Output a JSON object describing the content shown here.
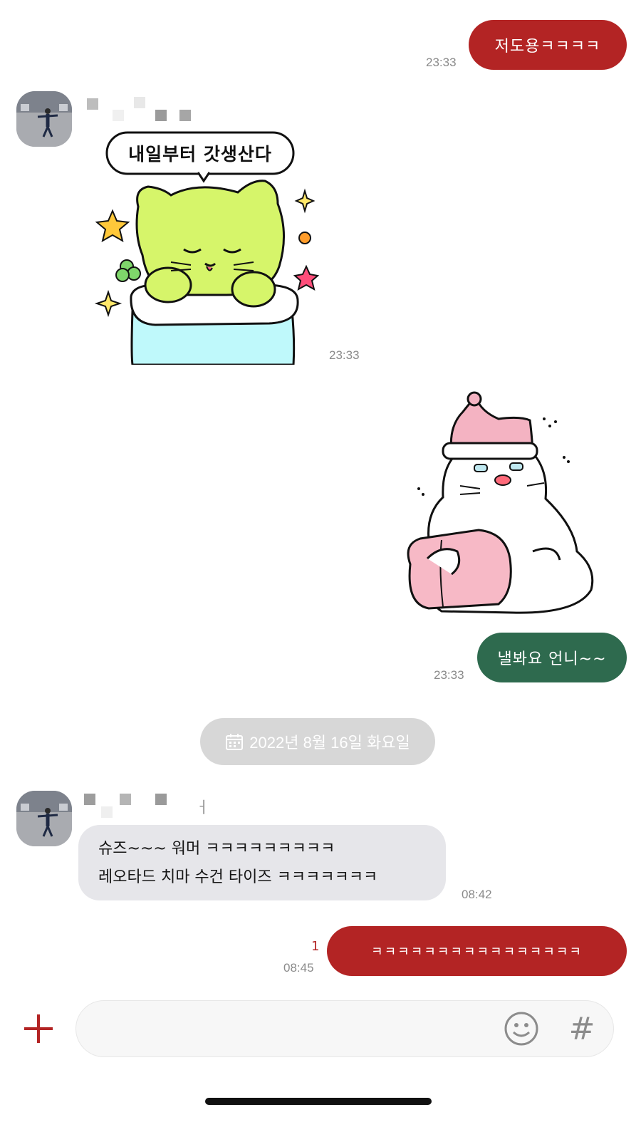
{
  "colors": {
    "my_bubble_red": "#b32424",
    "my_bubble_green": "#2e6a4e",
    "their_bubble": "#e6e6ea",
    "timestamp": "#8a8a8a",
    "unread": "#b32424",
    "date_pill": "#d7d7d7",
    "plus_red": "#b32424"
  },
  "messages": [
    {
      "sender": "me",
      "type": "text",
      "text": "저도용ㅋㅋㅋㅋ",
      "time": "23:33"
    },
    {
      "sender": "other",
      "type": "sticker",
      "sticker_text": "내일부터 갓생산다",
      "time": "23:33"
    },
    {
      "sender": "me",
      "type": "sticker"
    },
    {
      "sender": "me",
      "type": "text",
      "text": "낼봐요 언니~~",
      "time": "23:33"
    },
    {
      "sender": "other",
      "type": "text",
      "lines": [
        "슈즈~~~ 워머 ㅋㅋㅋㅋㅋㅋㅋㅋㅋ",
        "레오타드 치마 수건 타이즈 ㅋㅋㅋㅋㅋㅋㅋ"
      ],
      "time": "08:42"
    },
    {
      "sender": "me",
      "type": "text",
      "text": "ㅋㅋㅋㅋㅋㅋㅋㅋㅋㅋㅋㅋㅋㅋㅋㅋ",
      "time": "08:45",
      "unread": "1"
    }
  ],
  "date_divider": {
    "text": "2022년 8월 16일 화요일",
    "icon": "calendar-icon"
  },
  "second_sender_name_tail": "ㅓ",
  "input": {
    "placeholder": "",
    "icons": [
      "plus-icon",
      "emoji-icon",
      "hashtag-icon"
    ],
    "hashtag_glyph": "#"
  }
}
